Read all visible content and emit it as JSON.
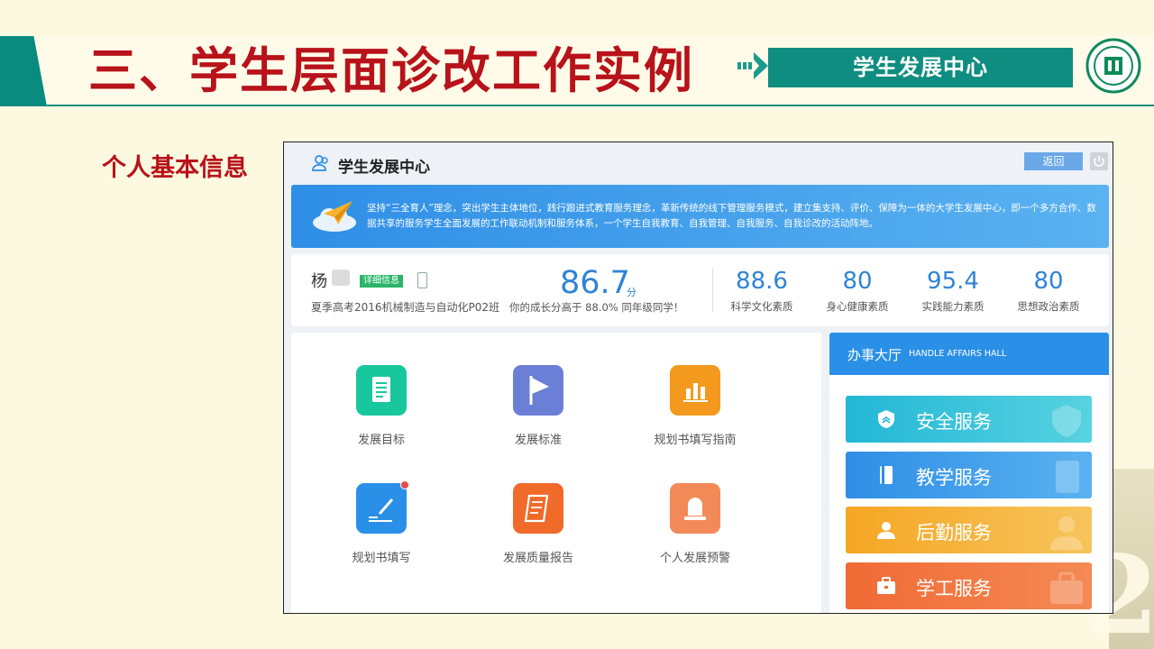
{
  "slide": {
    "title": "三、学生层面诊改工作实例",
    "banner": "学生发展中心",
    "section_label": "个人基本信息",
    "watermark_number": "2"
  },
  "app": {
    "title": "学生发展中心",
    "back_label": "返回",
    "intro": "坚持“三全育人”理念，突出学生主体地位，践行跟进式教育服务理念，革新传统的线下管理服务模式，建立集支持、评价、保障为一体的大学生发展中心，即一个多方合作、数据共享的服务学生全面发展的工作联动机制和服务体系，一个学生自我教育、自我管理、自我服务、自我诊改的活动阵地。",
    "profile": {
      "name": "杨",
      "detail_badge": "详细信息",
      "class": "夏季高考2016机械制造与自动化P02班",
      "score": "86.7",
      "score_unit": "分",
      "score_desc": "你的成长分高于 88.0% 同年级同学！",
      "stats": [
        {
          "value": "88.6",
          "label": "科学文化素质"
        },
        {
          "value": "80",
          "label": "身心健康素质"
        },
        {
          "value": "95.4",
          "label": "实践能力素质"
        },
        {
          "value": "80",
          "label": "思想政治素质"
        }
      ]
    },
    "functions": [
      {
        "label": "发展目标",
        "color": "#19c79c",
        "icon": "document-icon"
      },
      {
        "label": "发展标准",
        "color": "#6c7fd6",
        "icon": "flag-icon"
      },
      {
        "label": "规划书填写指南",
        "color": "#f39a1e",
        "icon": "bar-chart-icon"
      },
      {
        "label": "规划书填写",
        "color": "#2a8fe6",
        "icon": "pen-icon"
      },
      {
        "label": "发展质量报告",
        "color": "#f06a2a",
        "icon": "report-icon"
      },
      {
        "label": "个人发展预警",
        "color": "#f28a58",
        "icon": "alarm-icon"
      }
    ],
    "hall": {
      "title": "办事大厅",
      "subtitle": "HANDLE AFFAIRS HALL",
      "services": [
        {
          "label": "安全服务",
          "colors": [
            "#23b7d6",
            "#57d2e0"
          ],
          "icon": "shield-icon"
        },
        {
          "label": "教学服务",
          "colors": [
            "#2f8ee6",
            "#5ab2f0"
          ],
          "icon": "book-icon"
        },
        {
          "label": "后勤服务",
          "colors": [
            "#f5a623",
            "#f7c45c"
          ],
          "icon": "person-icon"
        },
        {
          "label": "学工服务",
          "colors": [
            "#f06a35",
            "#f48a55"
          ],
          "icon": "briefcase-icon"
        }
      ]
    }
  }
}
